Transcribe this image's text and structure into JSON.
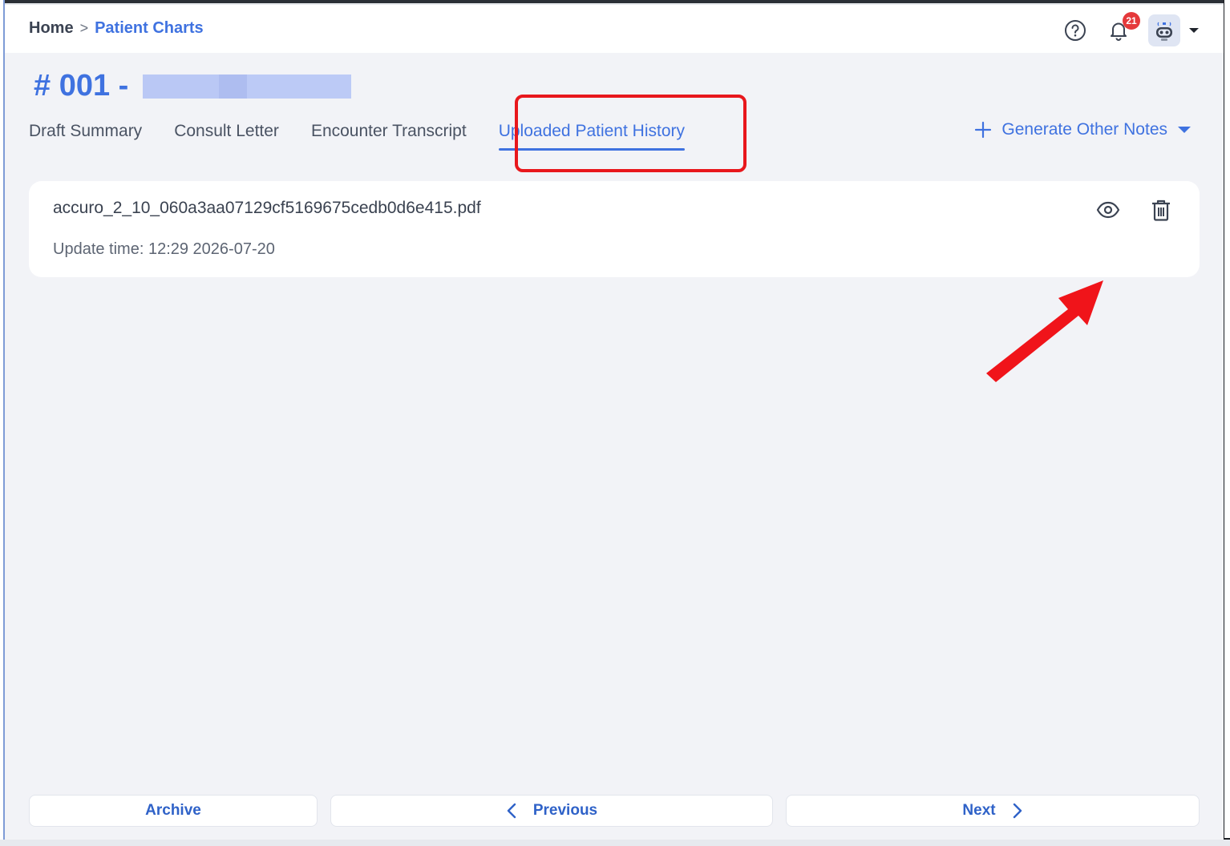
{
  "breadcrumb": {
    "home": "Home",
    "separator": ">",
    "current": "Patient Charts"
  },
  "notifications": {
    "count": "21"
  },
  "patient": {
    "title": "# 001 -"
  },
  "tabs": [
    {
      "label": "Draft Summary"
    },
    {
      "label": "Consult Letter"
    },
    {
      "label": "Encounter Transcript"
    },
    {
      "label": "Uploaded Patient History"
    }
  ],
  "actions": {
    "generate_notes": "Generate Other Notes"
  },
  "file": {
    "name": "accuro_2_10_060a3aa07129cf5169675cedb0d6e415.pdf",
    "update_time": "Update time: 12:29 2026-07-20"
  },
  "footer": {
    "archive": "Archive",
    "previous": "Previous",
    "next": "Next"
  },
  "colors": {
    "accent": "#3f72e0",
    "annotation_red": "#e8171c",
    "badge_red": "#e5393b"
  },
  "icons": [
    "help-icon",
    "bell-icon",
    "robot-avatar-icon",
    "caret-down-icon",
    "plus-icon",
    "eye-icon",
    "trash-icon",
    "chevron-left-icon",
    "chevron-right-icon"
  ]
}
